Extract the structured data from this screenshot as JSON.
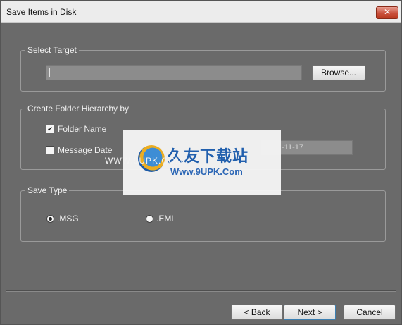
{
  "window": {
    "title": "Save Items in Disk",
    "close_symbol": "✕"
  },
  "select_target": {
    "legend": "Select Target",
    "path_value": "",
    "browse_label": "Browse..."
  },
  "folder_hierarchy": {
    "legend": "Create Folder Hierarchy by",
    "folder_name_label": "Folder Name",
    "folder_name_checked": true,
    "message_date_label": "Message Date",
    "message_date_checked": false,
    "date_value": "-11-17"
  },
  "save_type": {
    "legend": "Save Type",
    "options": [
      {
        "label": ".MSG",
        "selected": true
      },
      {
        "label": ".EML",
        "selected": false
      }
    ]
  },
  "footer": {
    "back_label": "< Back",
    "next_label": "Next >",
    "cancel_label": "Cancel"
  },
  "watermark": {
    "chinese_text": "久友下载站",
    "url_text": "Www.9UPK.Com",
    "side_text": "WWW.9UPK.COM"
  },
  "colors": {
    "background": "#6a6a6a",
    "titlebar": "#ececec",
    "close_button": "#c9503c",
    "watermark_blue": "#1f5fb0"
  },
  "icons": {
    "close": "close-icon",
    "checkbox_checked": "checkmark-icon",
    "radio_selected": "radio-dot-icon",
    "watermark_logo": "site-logo-icon"
  }
}
